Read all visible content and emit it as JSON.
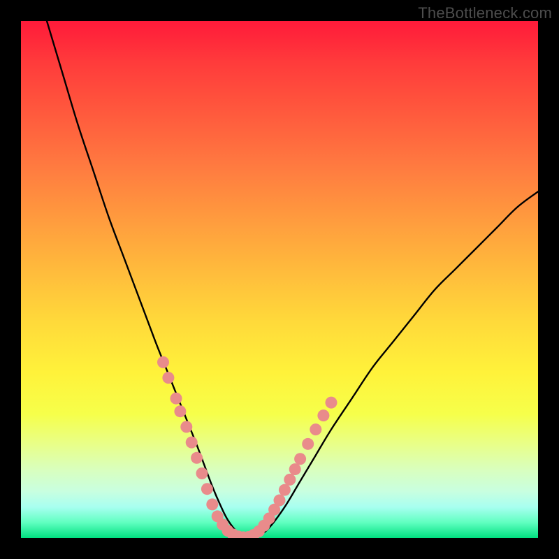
{
  "watermark": "TheBottleneck.com",
  "colors": {
    "frame": "#000000",
    "curve": "#000000",
    "marker_fill": "#e98b8b",
    "marker_stroke": "#cc6f6f",
    "gradient_top": "#ff1a3a",
    "gradient_bottom": "#00e080"
  },
  "chart_data": {
    "type": "line",
    "title": "",
    "xlabel": "",
    "ylabel": "",
    "xlim": [
      0,
      100
    ],
    "ylim": [
      0,
      100
    ],
    "grid": false,
    "legend": false,
    "series": [
      {
        "name": "bottleneck-curve",
        "x": [
          5,
          8,
          11,
          14,
          17,
          20,
          23,
          26,
          28,
          30,
          32,
          34,
          35.5,
          37,
          38.5,
          40,
          42,
          44,
          46,
          48,
          51,
          54,
          57,
          60,
          64,
          68,
          72,
          76,
          80,
          84,
          88,
          92,
          96,
          100
        ],
        "y": [
          100,
          90,
          80,
          71,
          62,
          54,
          46,
          38,
          33,
          28,
          23,
          18,
          14,
          10,
          6.5,
          3.5,
          1,
          0,
          0.5,
          2,
          6,
          11,
          16,
          21,
          27,
          33,
          38,
          43,
          48,
          52,
          56,
          60,
          64,
          67
        ]
      }
    ],
    "markers": {
      "name": "highlight-dots",
      "points": [
        {
          "x": 27.5,
          "y": 34
        },
        {
          "x": 28.5,
          "y": 31
        },
        {
          "x": 30.0,
          "y": 27
        },
        {
          "x": 30.8,
          "y": 24.5
        },
        {
          "x": 32.0,
          "y": 21.5
        },
        {
          "x": 33.0,
          "y": 18.5
        },
        {
          "x": 34.0,
          "y": 15.5
        },
        {
          "x": 35.0,
          "y": 12.5
        },
        {
          "x": 36.0,
          "y": 9.5
        },
        {
          "x": 37.0,
          "y": 6.5
        },
        {
          "x": 38.0,
          "y": 4.2
        },
        {
          "x": 39.0,
          "y": 2.6
        },
        {
          "x": 40.0,
          "y": 1.4
        },
        {
          "x": 41.0,
          "y": 0.7
        },
        {
          "x": 42.0,
          "y": 0.3
        },
        {
          "x": 43.0,
          "y": 0.15
        },
        {
          "x": 44.0,
          "y": 0.2
        },
        {
          "x": 45.0,
          "y": 0.6
        },
        {
          "x": 46.0,
          "y": 1.3
        },
        {
          "x": 47.0,
          "y": 2.4
        },
        {
          "x": 48.0,
          "y": 3.8
        },
        {
          "x": 49.0,
          "y": 5.5
        },
        {
          "x": 50.0,
          "y": 7.3
        },
        {
          "x": 51.0,
          "y": 9.3
        },
        {
          "x": 52.0,
          "y": 11.3
        },
        {
          "x": 53.0,
          "y": 13.3
        },
        {
          "x": 54.0,
          "y": 15.3
        },
        {
          "x": 55.5,
          "y": 18.2
        },
        {
          "x": 57.0,
          "y": 21.0
        },
        {
          "x": 58.5,
          "y": 23.7
        },
        {
          "x": 60.0,
          "y": 26.2
        }
      ]
    }
  }
}
